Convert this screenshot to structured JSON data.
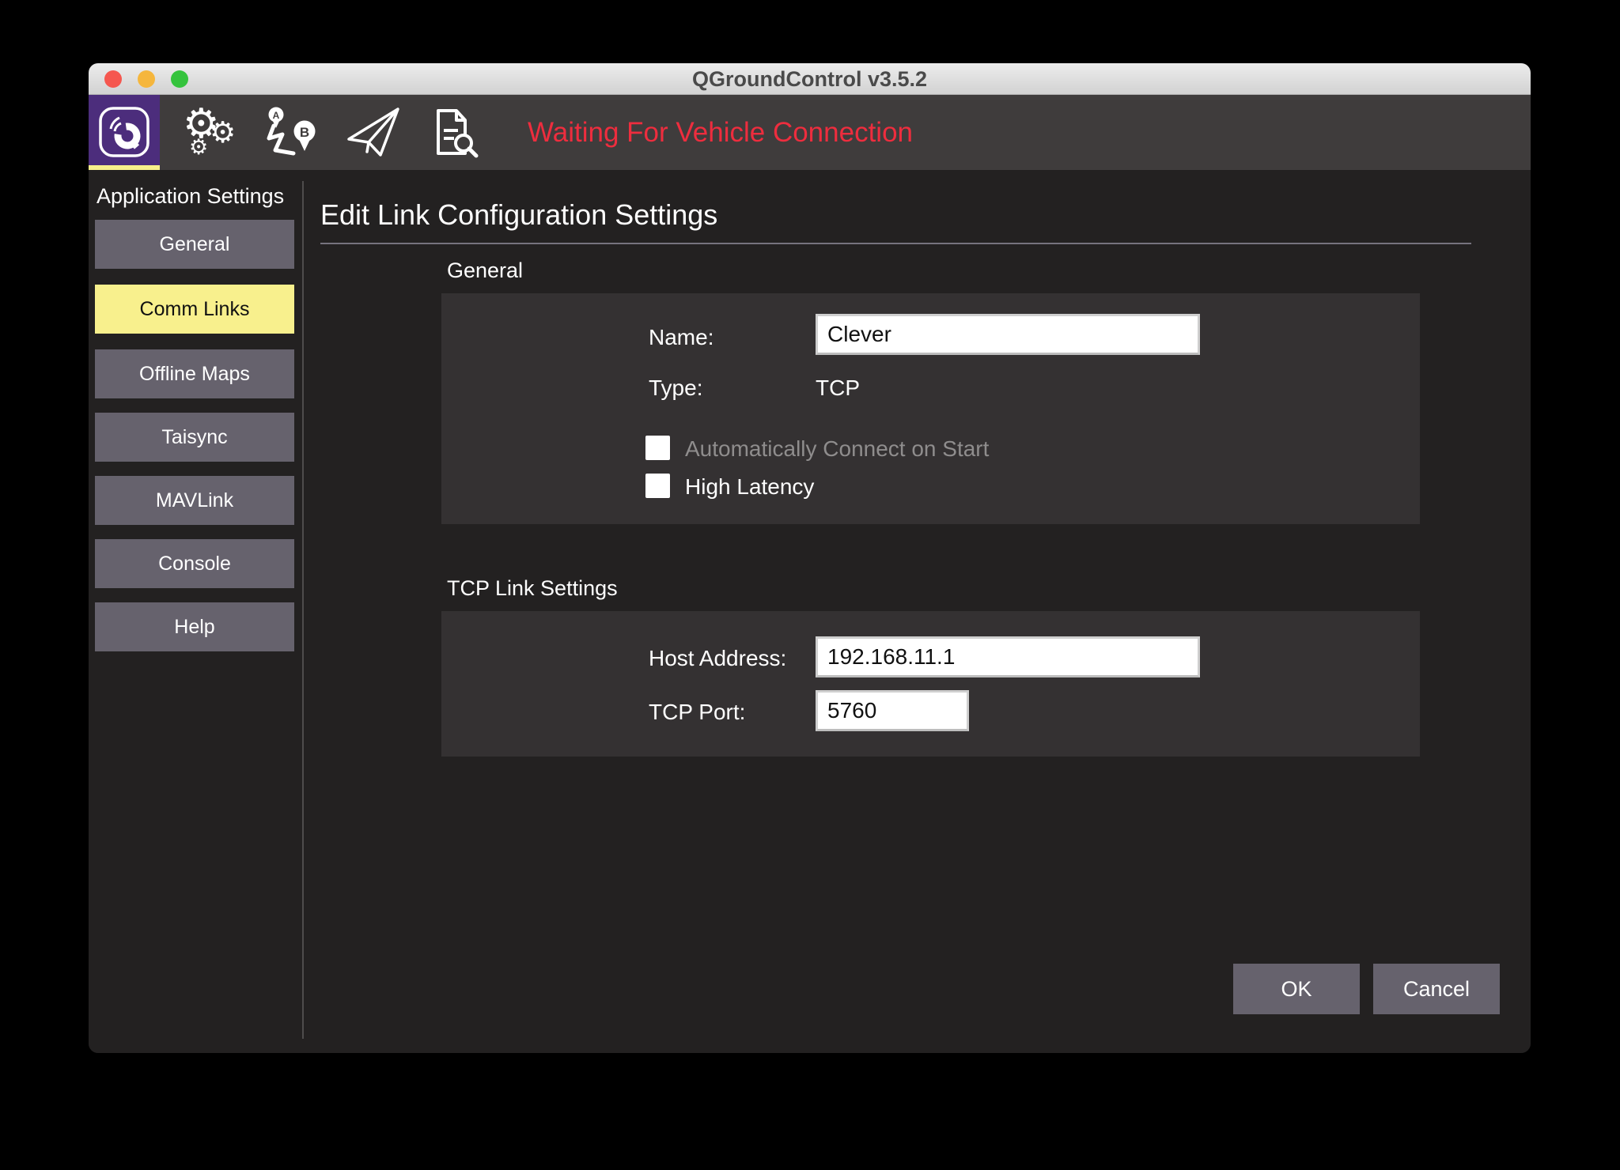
{
  "window": {
    "title": "QGroundControl v3.5.2",
    "traffic_lights": [
      "close",
      "minimize",
      "fullscreen"
    ]
  },
  "toolbar": {
    "status_text": "Waiting For Vehicle Connection",
    "icons": [
      "qgc-logo-icon",
      "vehicle-setup-gears-icon",
      "plan-route-icon",
      "fly-paper-plane-icon",
      "analyze-log-icon"
    ],
    "active_icon": "qgc-logo-icon"
  },
  "sidebar": {
    "title": "Application Settings",
    "items": [
      {
        "label": "General",
        "active": false
      },
      {
        "label": "Comm Links",
        "active": true
      },
      {
        "label": "Offline Maps",
        "active": false
      },
      {
        "label": "Taisync",
        "active": false
      },
      {
        "label": "MAVLink",
        "active": false
      },
      {
        "label": "Console",
        "active": false
      },
      {
        "label": "Help",
        "active": false
      }
    ]
  },
  "main": {
    "heading": "Edit Link Configuration Settings",
    "general_section": {
      "title": "General",
      "name_label": "Name:",
      "name_value": "Clever",
      "type_label": "Type:",
      "type_value": "TCP",
      "auto_connect_label": "Automatically Connect on Start",
      "auto_connect_checked": false,
      "auto_connect_enabled": false,
      "high_latency_label": "High Latency",
      "high_latency_checked": false
    },
    "tcp_section": {
      "title": "TCP Link Settings",
      "host_label": "Host Address:",
      "host_value": "192.168.11.1",
      "port_label": "TCP Port:",
      "port_value": "5760"
    },
    "buttons": {
      "ok": "OK",
      "cancel": "Cancel"
    }
  },
  "colors": {
    "accent_purple": "#4c2d7c",
    "highlight_yellow": "#f8f08d",
    "status_red": "#ee2d3e",
    "toolbar_bg": "#3f3c3c",
    "content_bg": "#232121",
    "panel_bg": "#343132",
    "button_bg": "#66626d"
  }
}
